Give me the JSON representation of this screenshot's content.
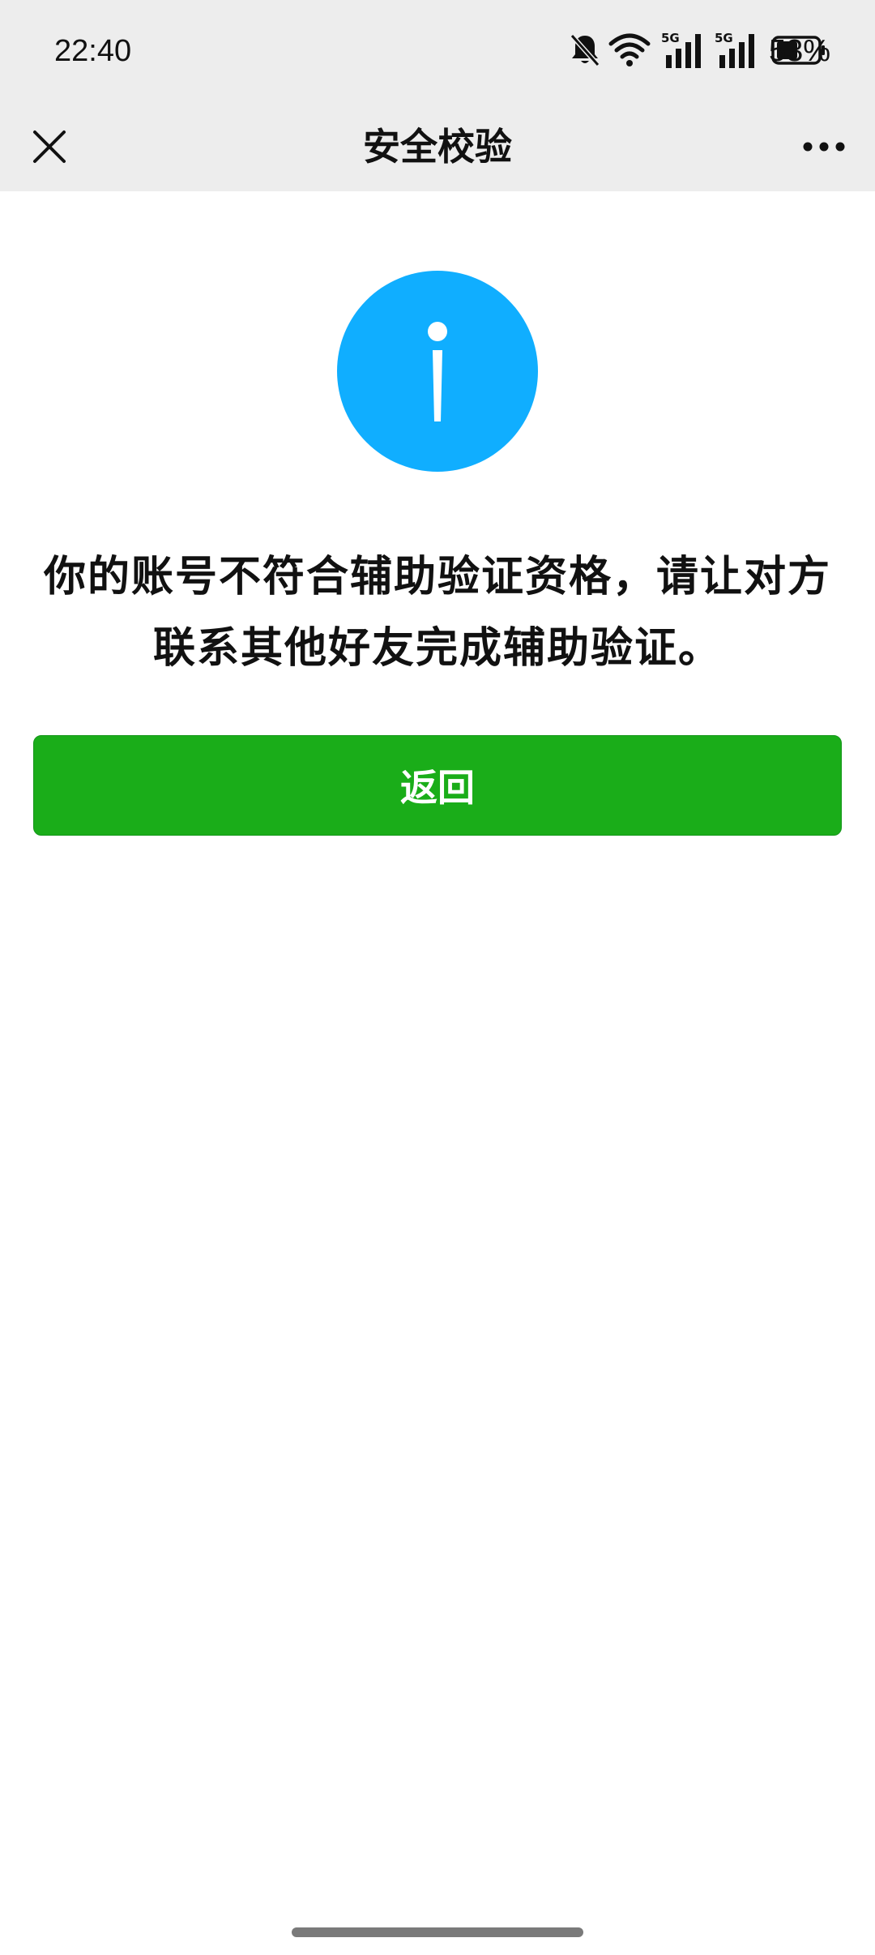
{
  "status_bar": {
    "time": "22:40",
    "battery_percent": "53%",
    "battery_level": 0.53,
    "icons": [
      "bell-muted-icon",
      "wifi-icon",
      "signal-5g-icon",
      "signal-5g-icon",
      "battery-icon"
    ],
    "signal_label_1": "5G",
    "signal_label_2": "5G"
  },
  "nav": {
    "title": "安全校验",
    "close_icon": "close-icon",
    "more_icon": "more-icon"
  },
  "content": {
    "icon": "info-icon",
    "message": "你的账号不符合辅助验证资格，请让对方联系其他好友完成辅助验证。",
    "back_button_label": "返回"
  },
  "colors": {
    "accent_green": "#1aad19",
    "info_blue": "#10aeff",
    "bar_gray": "#ededed"
  }
}
